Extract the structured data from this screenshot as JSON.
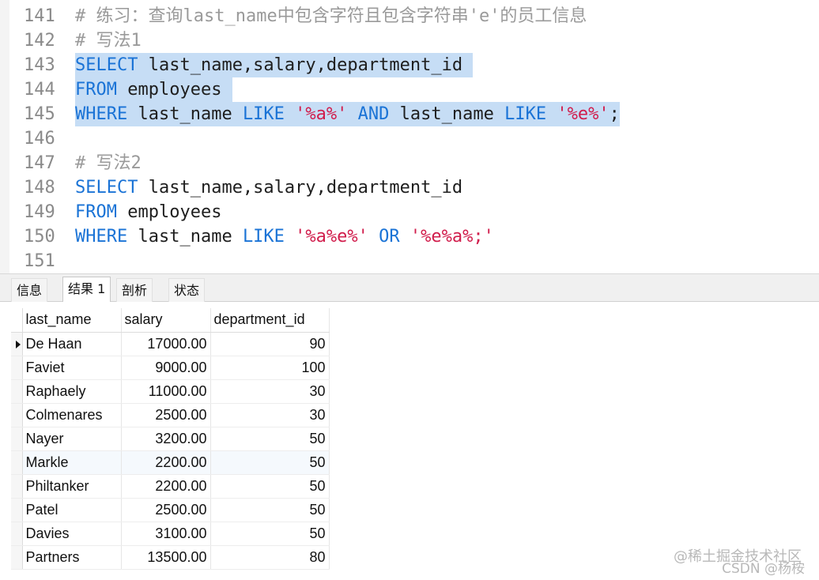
{
  "editor": {
    "lines": [
      {
        "num": "141",
        "tokens": [
          {
            "t": "cm",
            "v": "# 练习：查询last_name中包含字符且包含字符串'e'的员工信息"
          }
        ]
      },
      {
        "num": "142",
        "tokens": [
          {
            "t": "cm",
            "v": "# 写法1"
          }
        ]
      },
      {
        "num": "143",
        "highlight": true,
        "tokens": [
          {
            "t": "kw",
            "v": "SELECT"
          },
          {
            "t": "tx",
            "v": " last_name,salary,department_id "
          }
        ]
      },
      {
        "num": "144",
        "highlight": true,
        "tokens": [
          {
            "t": "kw",
            "v": "FROM"
          },
          {
            "t": "tx",
            "v": " employees "
          }
        ]
      },
      {
        "num": "145",
        "highlight": true,
        "tokens": [
          {
            "t": "kw",
            "v": "WHERE"
          },
          {
            "t": "tx",
            "v": " last_name "
          },
          {
            "t": "kw",
            "v": "LIKE"
          },
          {
            "t": "tx",
            "v": " "
          },
          {
            "t": "str",
            "v": "'%a%'"
          },
          {
            "t": "tx",
            "v": " "
          },
          {
            "t": "kw",
            "v": "AND"
          },
          {
            "t": "tx",
            "v": " last_name "
          },
          {
            "t": "kw",
            "v": "LIKE"
          },
          {
            "t": "tx",
            "v": " "
          },
          {
            "t": "str",
            "v": "'%e%'"
          },
          {
            "t": "tx",
            "v": ";"
          }
        ]
      },
      {
        "num": "146",
        "tokens": []
      },
      {
        "num": "147",
        "tokens": [
          {
            "t": "cm",
            "v": "# 写法2"
          }
        ]
      },
      {
        "num": "148",
        "tokens": [
          {
            "t": "kw",
            "v": "SELECT"
          },
          {
            "t": "tx",
            "v": " last_name,salary,department_id"
          }
        ]
      },
      {
        "num": "149",
        "tokens": [
          {
            "t": "kw",
            "v": "FROM"
          },
          {
            "t": "tx",
            "v": " employees"
          }
        ]
      },
      {
        "num": "150",
        "tokens": [
          {
            "t": "kw",
            "v": "WHERE"
          },
          {
            "t": "tx",
            "v": " last_name "
          },
          {
            "t": "kw",
            "v": "LIKE"
          },
          {
            "t": "tx",
            "v": " "
          },
          {
            "t": "str",
            "v": "'%a%e%'"
          },
          {
            "t": "tx",
            "v": " "
          },
          {
            "t": "kw",
            "v": "OR"
          },
          {
            "t": "tx",
            "v": " "
          },
          {
            "t": "str",
            "v": "'%e%a%;'"
          }
        ]
      },
      {
        "num": "151",
        "tokens": []
      }
    ]
  },
  "tabs": [
    {
      "label": "信息",
      "active": false
    },
    {
      "label": "结果 1",
      "active": true
    },
    {
      "label": "剖析",
      "active": false
    },
    {
      "label": "状态",
      "active": false
    }
  ],
  "result": {
    "columns": [
      "last_name",
      "salary",
      "department_id"
    ],
    "rows": [
      [
        "De Haan",
        "17000.00",
        "90"
      ],
      [
        "Faviet",
        "9000.00",
        "100"
      ],
      [
        "Raphaely",
        "11000.00",
        "30"
      ],
      [
        "Colmenares",
        "2500.00",
        "30"
      ],
      [
        "Nayer",
        "3200.00",
        "50"
      ],
      [
        "Markle",
        "2200.00",
        "50"
      ],
      [
        "Philtanker",
        "2200.00",
        "50"
      ],
      [
        "Patel",
        "2500.00",
        "50"
      ],
      [
        "Davies",
        "3100.00",
        "50"
      ],
      [
        "Partners",
        "13500.00",
        "80"
      ]
    ],
    "current_row_index": 0,
    "alt_row_index": 5
  },
  "watermark": {
    "line1": "@稀土掘金技术社区",
    "line2": "CSDN @杨桉"
  }
}
